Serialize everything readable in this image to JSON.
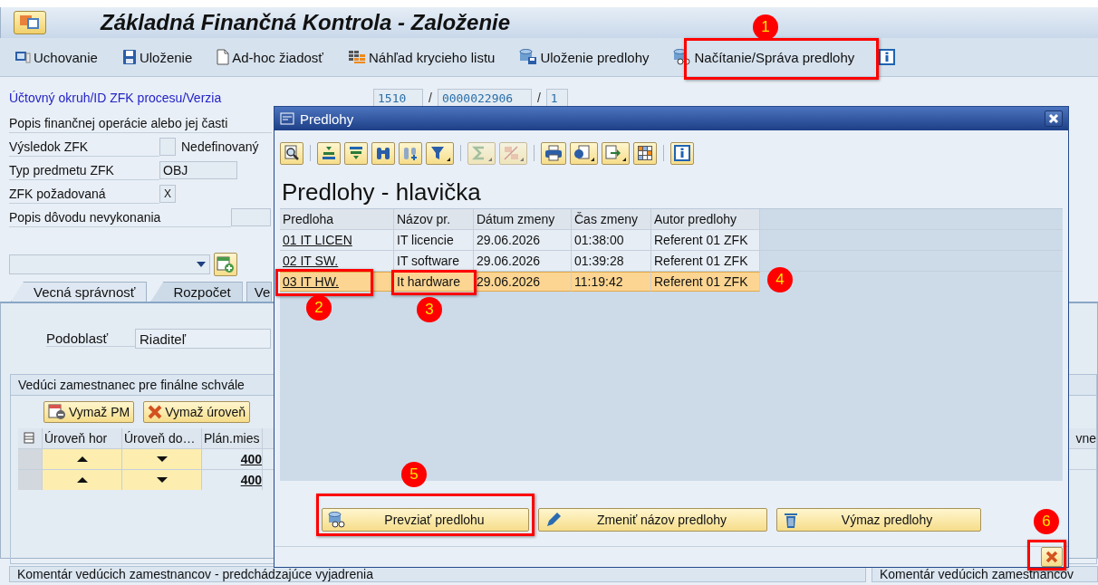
{
  "window": {
    "title": "Základná Finančná Kontrola - Založenie"
  },
  "toolbar": [
    {
      "label": "Uchovanie"
    },
    {
      "label": "Uloženie"
    },
    {
      "label": "Ad-hoc žiadosť"
    },
    {
      "label": "Náhľad krycieho listu"
    },
    {
      "label": "Uloženie predlohy"
    },
    {
      "label": "Načítanie/Správa predlohy"
    }
  ],
  "key_row": {
    "label": "Účtovný okruh/ID ZFK procesu/Verzia",
    "values": [
      "1510",
      "0000022906",
      "1"
    ],
    "separator": "/"
  },
  "fields": [
    {
      "label": "Popis finančnej operácie alebo jej časti",
      "kind": "label"
    },
    {
      "label": "Výsledok ZFK",
      "kind": "check",
      "description": "Nedefinovaný"
    },
    {
      "label": "Typ predmetu ZFK",
      "kind": "text",
      "value": "OBJ"
    },
    {
      "label": "ZFK požadovaná",
      "kind": "check",
      "value": "X"
    },
    {
      "label": "Popis dôvodu nevykonania",
      "kind": "far"
    }
  ],
  "tabs": [
    {
      "label": "Vecná správnosť",
      "selected": true
    },
    {
      "label": "Rozpočet",
      "selected": false
    },
    {
      "label": "Ve",
      "selected": false
    }
  ],
  "subarea": {
    "label": "Podoblasť",
    "value": "Riaditeľ"
  },
  "group": {
    "title": "Vedúci zamestnanec pre finálne schvále",
    "buttons": [
      "Vymaž PM",
      "Vymaž úroveň"
    ],
    "columns": [
      "Úroveň hor",
      "Úroveň do…",
      "Plán.mies",
      "vne"
    ],
    "rows": [
      {
        "column_3": "400"
      },
      {
        "column_3": "400"
      }
    ]
  },
  "comments": [
    "Komentár vedúcich zamestnancov - predchádzajúce vyjadrenia",
    "Komentár vedúcich zamestnancov"
  ],
  "dialog": {
    "title": "Predlohy",
    "toolbar": [
      {
        "kind": "details",
        "disabled": false,
        "menu": false
      },
      {
        "kind": "sort_up",
        "disabled": false,
        "menu": false
      },
      {
        "kind": "sort_down",
        "disabled": false,
        "menu": false
      },
      {
        "kind": "find",
        "disabled": false,
        "menu": false
      },
      {
        "kind": "find_next",
        "disabled": false,
        "menu": false
      },
      {
        "kind": "filter",
        "disabled": false,
        "menu": true
      },
      {
        "kind": "sum",
        "disabled": true,
        "menu": true
      },
      {
        "kind": "subtotal",
        "disabled": true,
        "menu": true
      },
      {
        "kind": "print",
        "disabled": false,
        "menu": false
      },
      {
        "kind": "views",
        "disabled": false,
        "menu": true
      },
      {
        "kind": "export",
        "disabled": false,
        "menu": true
      },
      {
        "kind": "layout",
        "disabled": false,
        "menu": false
      },
      {
        "kind": "info",
        "disabled": false,
        "menu": false
      }
    ],
    "heading": "Predlohy - hlavička",
    "columns": [
      "Predloha",
      "Názov pr.",
      "Dátum zmeny",
      "Čas zmeny",
      "Autor predlohy"
    ],
    "rows": [
      {
        "cells": [
          "01 IT LICEN",
          "IT licencie",
          "29.06.2026",
          "01:38:00",
          "Referent 01 ZFK"
        ],
        "selected": false
      },
      {
        "cells": [
          "02 IT SW.",
          "IT software",
          "29.06.2026",
          "01:39:28",
          "Referent 01 ZFK"
        ],
        "selected": false
      },
      {
        "cells": [
          "03 IT HW.",
          "It hardware",
          "29.06.2026",
          "11:19:42",
          "Referent 01 ZFK"
        ],
        "selected": true
      }
    ],
    "buttons": [
      "Prevziať predlohu",
      "Zmeniť názov predlohy",
      "Výmaz predlohy"
    ]
  },
  "annotations": [
    {
      "number": "1",
      "frame": true
    },
    {
      "number": "2",
      "frame": true
    },
    {
      "number": "3",
      "frame": true
    },
    {
      "number": "4",
      "frame": false
    },
    {
      "number": "5",
      "frame": true
    },
    {
      "number": "6",
      "frame": true
    }
  ]
}
